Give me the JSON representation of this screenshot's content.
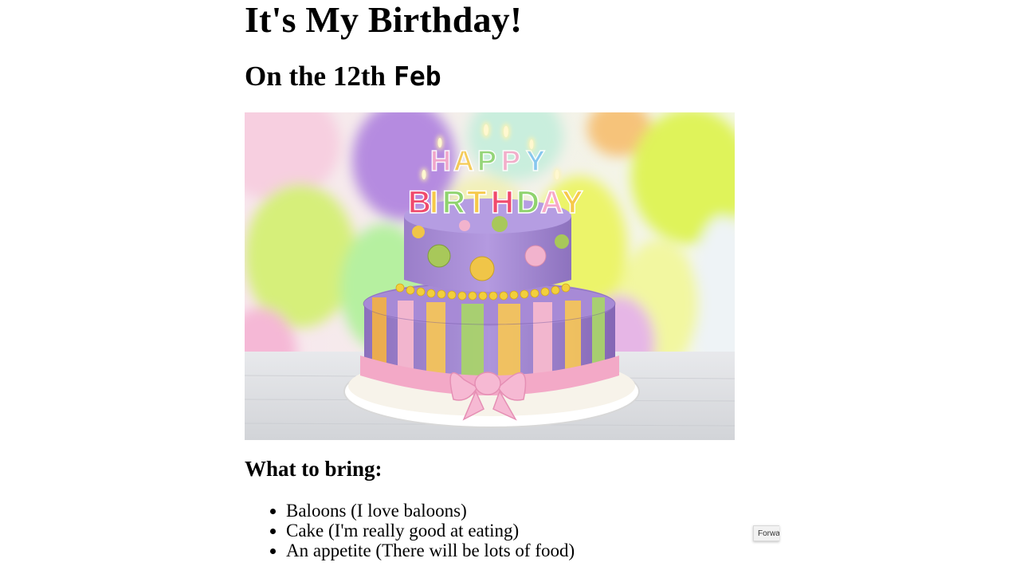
{
  "page": {
    "title": "It's My Birthday!",
    "date_text": "On the 12th",
    "month_code": "Feb",
    "image": {
      "alt": "Birthday cake with candles",
      "candle_letters_top": "HAPPY",
      "candle_letters_bottom": "BIRTHDAY"
    },
    "bring_heading": "What to bring:",
    "bring_items": [
      "Baloons (I love baloons)",
      "Cake (I'm really good at eating)",
      "An appetite (There will be lots of food)"
    ]
  },
  "overlay": {
    "forward_label": "Forwa"
  },
  "colors": {
    "text": "#000000",
    "background": "#ffffff"
  }
}
